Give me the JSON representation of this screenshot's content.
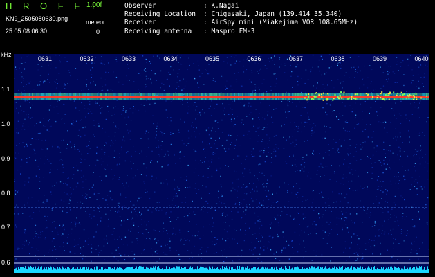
{
  "header": {
    "brand": "H R O F F T",
    "version": "1.00f",
    "filename": "KN9_2505080630.png",
    "datetime": "25.05.08 06:30",
    "meteor_label": "meteor",
    "meteor_count": "0"
  },
  "info": {
    "rows": [
      {
        "key": "Observer",
        "value": "K.Nagai"
      },
      {
        "key": "Receiving Location",
        "value": "Chigasaki, Japan (139.414 35.340)"
      },
      {
        "key": "Receiver",
        "value": "AirSpy mini (Miakejima VOR 108.65MHz)"
      },
      {
        "key": "Receiving antenna",
        "value": "Maspro FM-3"
      }
    ]
  },
  "spectrogram": {
    "y_unit": "kHz",
    "y_ticks": [
      "1.1",
      "1.0",
      "0.9",
      "0.8",
      "0.7",
      "0.6"
    ],
    "time_labels": [
      "0631",
      "0632",
      "0633",
      "0634",
      "0635",
      "0636",
      "0637",
      "0638",
      "0639",
      "0640"
    ],
    "colors": {
      "background": "#00085a",
      "carrier": "#ff3a2a",
      "baseline": "#1ad7ff"
    }
  }
}
